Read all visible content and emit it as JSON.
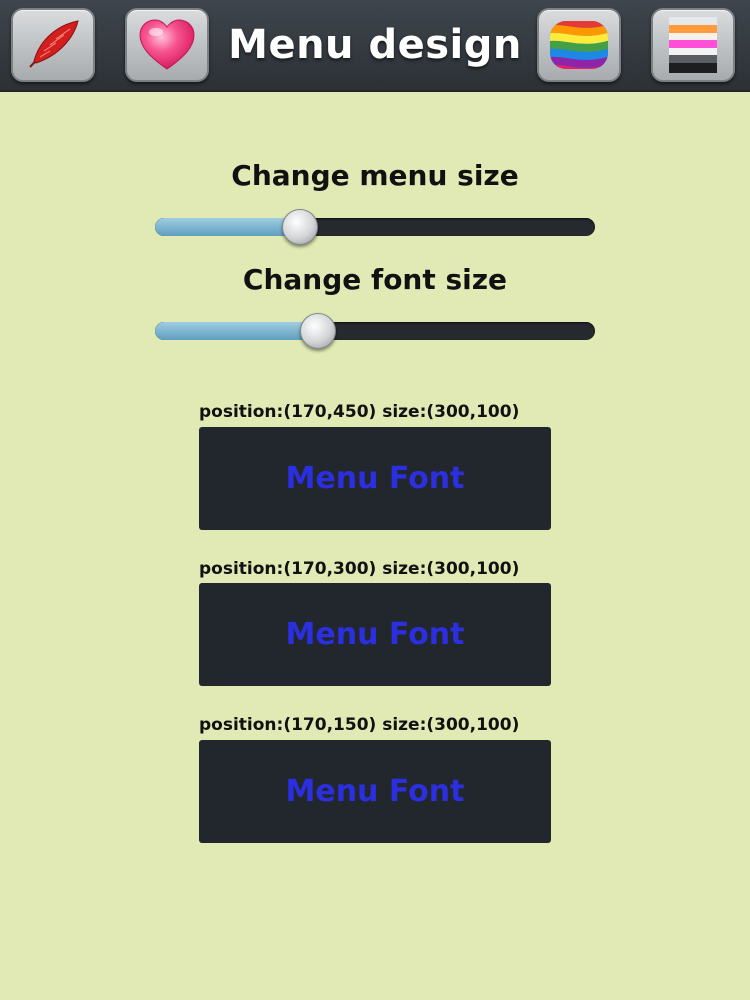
{
  "header": {
    "title": "Menu design",
    "buttons": [
      {
        "icon": "feather-icon"
      },
      {
        "icon": "heart-icon"
      },
      {
        "icon": "rainbow-palette-icon"
      },
      {
        "icon": "color-stripes-icon"
      }
    ]
  },
  "controls": {
    "menu_size_label": "Change menu size",
    "menu_size_value": 0.33,
    "font_size_label": "Change font size",
    "font_size_value": 0.37
  },
  "menus": [
    {
      "info": "position:(170,450) size:(300,100)",
      "label": "Menu Font"
    },
    {
      "info": "position:(170,300) size:(300,100)",
      "label": "Menu Font"
    },
    {
      "info": "position:(170,150) size:(300,100)",
      "label": "Menu Font"
    }
  ],
  "colors": {
    "background": "#e1eab4",
    "toolbar": "#353b41",
    "menu_box": "#22272d",
    "menu_font": "#2b2fe0",
    "slider_fill": "#7fb6d0"
  }
}
